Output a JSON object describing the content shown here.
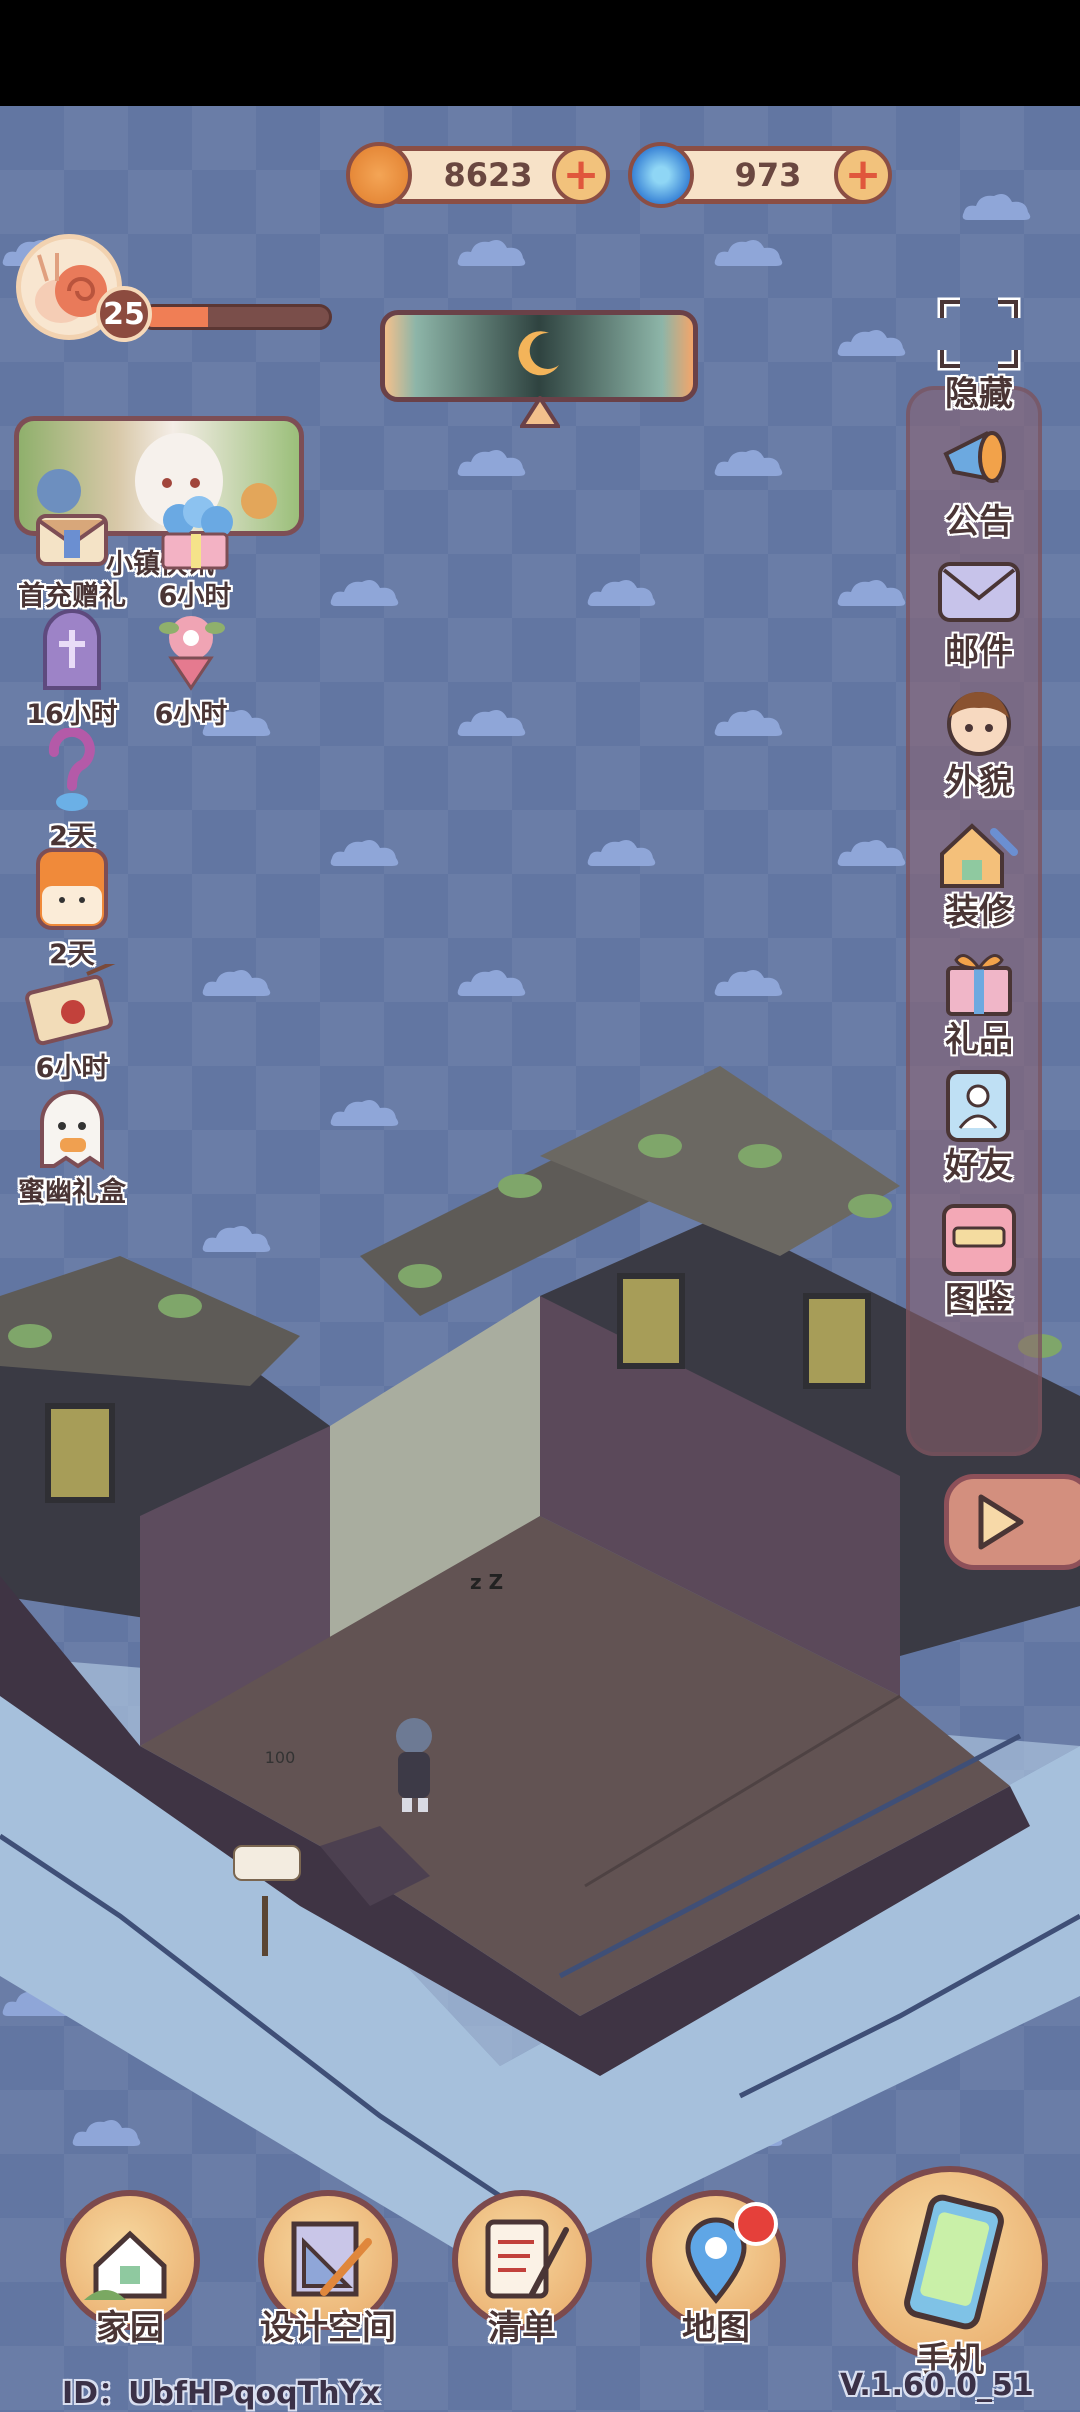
{
  "player": {
    "level": "25",
    "xp_fraction": 0.35
  },
  "currencies": [
    {
      "name": "coin",
      "amount": "8623"
    },
    {
      "name": "spiral-gem",
      "amount": "973"
    }
  ],
  "news": {
    "label": "小镇快讯"
  },
  "events": [
    {
      "icon": "envelope-gift-icon",
      "label": "首充赠礼"
    },
    {
      "icon": "flower-gift-box-icon",
      "label": "6小时"
    },
    {
      "icon": "purple-tombstone-icon",
      "label": "16小时"
    },
    {
      "icon": "flower-bundle-icon",
      "label": "6小时"
    },
    {
      "icon": "question-mark-icon",
      "label": "2天"
    },
    {
      "icon": "orange-juice-box-icon",
      "label": "2天"
    },
    {
      "icon": "wax-sealed-letter-icon",
      "label": "6小时"
    },
    {
      "icon": "ghost-candy-icon",
      "label": "蜜幽礼盒"
    }
  ],
  "right_menu": [
    {
      "icon": "hide-frame-icon",
      "label": "隐藏"
    },
    {
      "icon": "megaphone-icon",
      "label": "公告"
    },
    {
      "icon": "envelope-icon",
      "label": "邮件"
    },
    {
      "icon": "avatar-face-icon",
      "label": "外貌"
    },
    {
      "icon": "house-wrench-icon",
      "label": "装修"
    },
    {
      "icon": "gift-box-icon",
      "label": "礼品"
    },
    {
      "icon": "friend-card-icon",
      "label": "好友"
    },
    {
      "icon": "catalog-book-icon",
      "label": "图鉴"
    }
  ],
  "scene": {
    "signpost_value": "100",
    "sleep_text": "z Z"
  },
  "bottom_nav": [
    {
      "icon": "house-icon",
      "label": "家园"
    },
    {
      "icon": "ruler-triangle-icon",
      "label": "设计空间"
    },
    {
      "icon": "list-quill-icon",
      "label": "清单"
    },
    {
      "icon": "map-pin-icon",
      "label": "地图"
    },
    {
      "icon": "phone-icon",
      "label": "手机"
    }
  ],
  "footer": {
    "id_text": "ID：UbfHPqoqThYx",
    "version": "V.1.60.0_51"
  },
  "colors": {
    "background": "#6276a2",
    "panel": "#8c606e",
    "accent": "#f07e55",
    "outline": "#7c4a4d"
  }
}
